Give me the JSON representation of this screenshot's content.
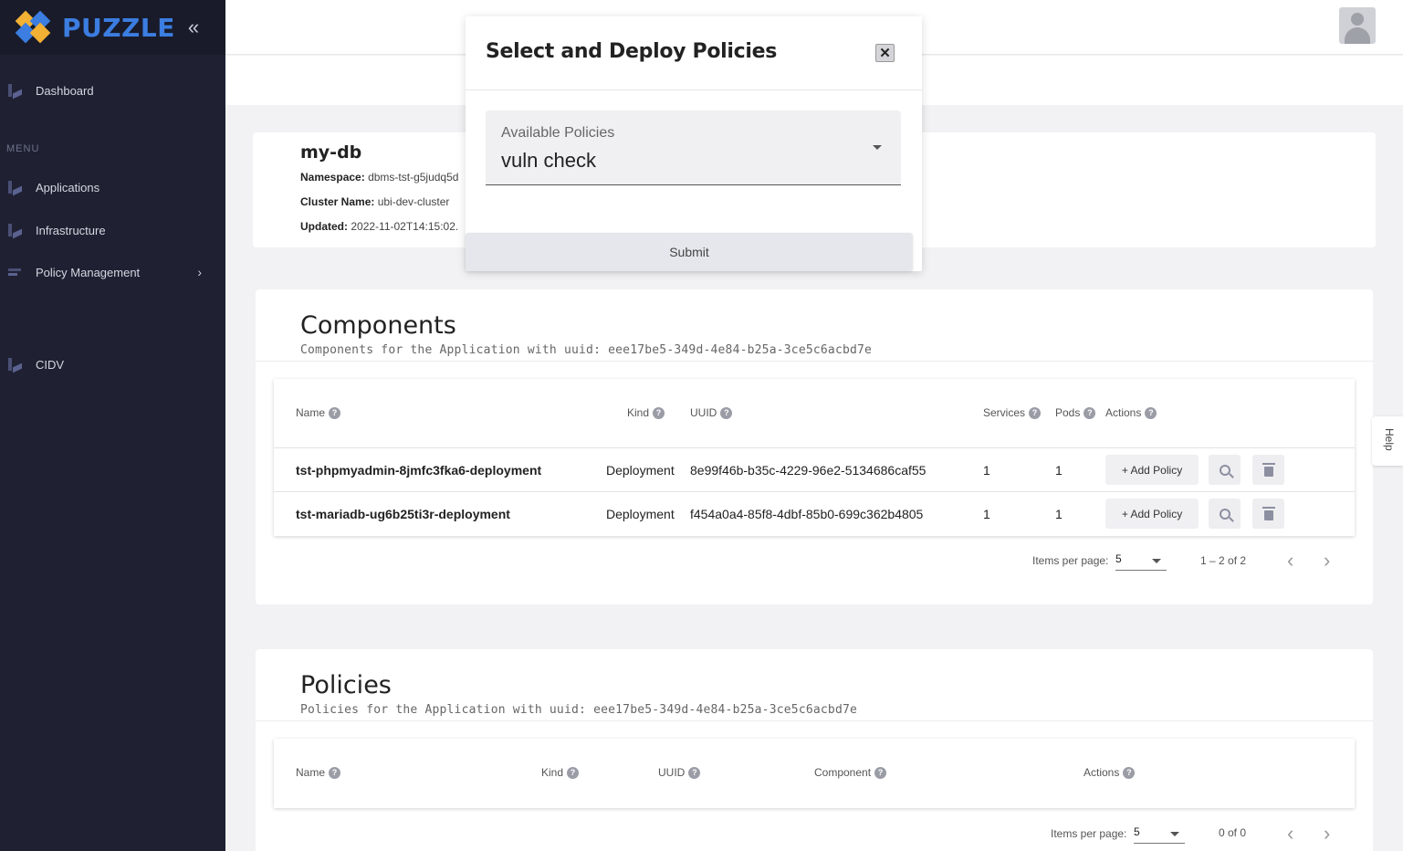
{
  "brand": {
    "name": "PUZZLE",
    "collapse_glyph": "«"
  },
  "sidebar": {
    "menu_label": "MENU",
    "items": [
      {
        "label": "Dashboard",
        "icon": "chart-icon"
      },
      {
        "label": "Applications",
        "icon": "chart-icon"
      },
      {
        "label": "Infrastructure",
        "icon": "chart-icon"
      },
      {
        "label": "Policy Management",
        "icon": "list-icon",
        "chevron": "›"
      },
      {
        "label": "CIDV",
        "icon": "chart-icon"
      }
    ]
  },
  "app": {
    "name": "my-db",
    "namespace_label": "Namespace:",
    "namespace": "dbms-tst-g5judq5d",
    "cluster_label": "Cluster Name:",
    "cluster": "ubi-dev-cluster",
    "updated_label": "Updated:",
    "updated": "2022-11-02T14:15:02."
  },
  "components": {
    "title": "Components",
    "subtitle": "Components for the Application with uuid: eee17be5-349d-4e84-b25a-3ce5c6acbd7e",
    "headers": {
      "name": "Name",
      "kind": "Kind",
      "uuid": "UUID",
      "services": "Services",
      "pods": "Pods",
      "actions": "Actions"
    },
    "rows": [
      {
        "name": "tst-phpmyadmin-8jmfc3fka6-deployment",
        "kind": "Deployment",
        "uuid": "8e99f46b-b35c-4229-96e2-5134686caf55",
        "services": "1",
        "pods": "1",
        "add_label": "+ Add Policy"
      },
      {
        "name": "tst-mariadb-ug6b25ti3r-deployment",
        "kind": "Deployment",
        "uuid": "f454a0a4-85f8-4dbf-85b0-699c362b4805",
        "services": "1",
        "pods": "1",
        "add_label": "+ Add Policy"
      }
    ],
    "pager": {
      "items_label": "Items per page:",
      "page_size": "5",
      "range": "1 – 2 of 2"
    }
  },
  "policies": {
    "title": "Policies",
    "subtitle": "Policies for the Application with uuid: eee17be5-349d-4e84-b25a-3ce5c6acbd7e",
    "headers": {
      "name": "Name",
      "kind": "Kind",
      "uuid": "UUID",
      "component": "Component",
      "actions": "Actions"
    },
    "pager": {
      "items_label": "Items per page:",
      "page_size": "5",
      "range": "0 of 0"
    }
  },
  "help_label": "Help",
  "modal": {
    "title": "Select and Deploy Policies",
    "close_glyph": "✕",
    "field_label": "Available Policies",
    "field_value": "vuln check",
    "submit_label": "Submit"
  },
  "colors": {
    "sidebar_bg": "#1f2133",
    "brand_blue": "#3b7de0",
    "page_bg": "#f2f2f4"
  }
}
